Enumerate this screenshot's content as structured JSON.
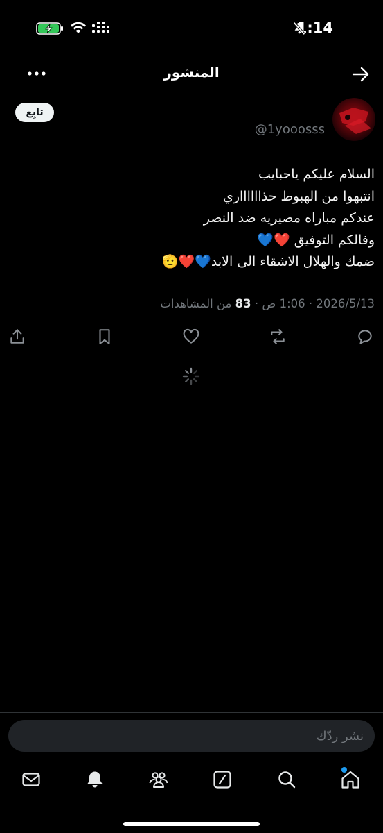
{
  "status_bar": {
    "time": "1:14"
  },
  "header": {
    "title": "المنشور"
  },
  "post": {
    "handle": "@1yooosss",
    "follow_label": "تابِع",
    "lines": [
      "السلام عليكم ياحبايب",
      "انتبهوا من الهبوط حذااااااري",
      "عندكم مباراه مصيريه ضد النصر",
      "وفالكم التوفيق ❤️💙",
      "ضمك والهلال الاشقاء الى الابد💙❤️🫡"
    ],
    "date": "2026/5/13",
    "time": "1:06 ص",
    "views_count": "83",
    "views_label": "من المشاهدات"
  },
  "composer": {
    "placeholder": "نشر ردّك"
  },
  "colors": {
    "background": "#000000",
    "muted_text": "#71767b",
    "accent": "#1d9bf0"
  }
}
